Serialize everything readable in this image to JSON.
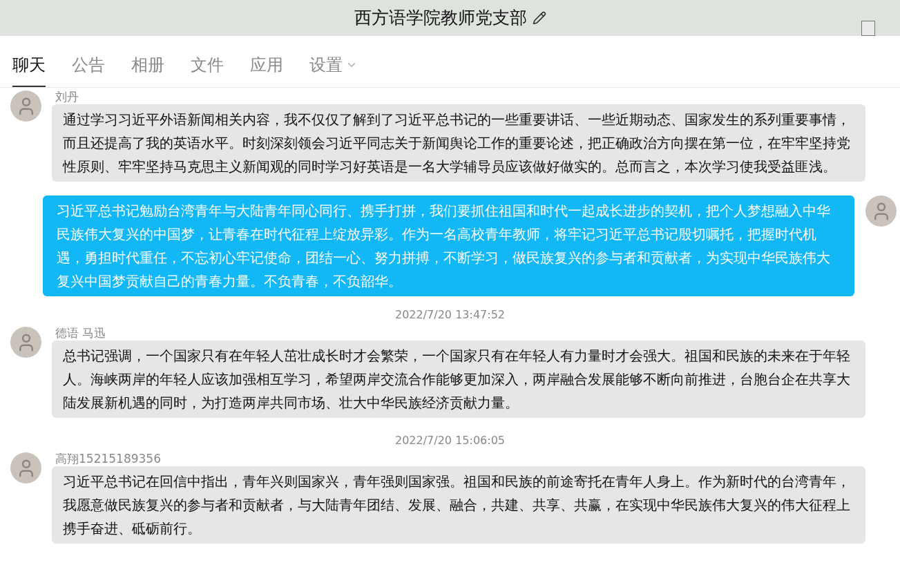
{
  "header": {
    "title": "西方语学院教师党支部"
  },
  "tabs": [
    {
      "label": "聊天",
      "selected": true,
      "dropdown": false
    },
    {
      "label": "公告",
      "selected": false,
      "dropdown": false
    },
    {
      "label": "相册",
      "selected": false,
      "dropdown": false
    },
    {
      "label": "文件",
      "selected": false,
      "dropdown": false
    },
    {
      "label": "应用",
      "selected": false,
      "dropdown": false
    },
    {
      "label": "设置",
      "selected": false,
      "dropdown": true
    }
  ],
  "messages": [
    {
      "kind": "received",
      "sender": "刘丹",
      "text": "通过学习习近平外语新闻相关内容，我不仅仅了解到了习近平总书记的一些重要讲话、一些近期动态、国家发生的系列重要事情，而且还提高了我的英语水平。时刻深刻领会习近平同志关于新闻舆论工作的重要论述，把正确政治方向摆在第一位，在牢牢坚持党性原则、牢牢坚持马克思主义新闻观的同时学习好英语是一名大学辅导员应该做好做实的。总而言之，本次学习使我受益匪浅。"
    },
    {
      "kind": "sent",
      "text": "习近平总书记勉励台湾青年与大陆青年同心同行、携手打拼，我们要抓住祖国和时代一起成长进步的契机，把个人梦想融入中华民族伟大复兴的中国梦，让青春在时代征程上绽放异彩。作为一名高校青年教师，将牢记习近平总书记殷切嘱托，把握时代机遇，勇担时代重任，不忘初心牢记使命，团结一心、努力拼搏，不断学习，做民族复兴的参与者和贡献者，为实现中华民族伟大复兴中国梦贡献自己的青春力量。不负青春，不负韶华。"
    },
    {
      "kind": "time",
      "text": "2022/7/20 13:47:52"
    },
    {
      "kind": "received",
      "sender": "德语 马迅",
      "text": "总书记强调，一个国家只有在年轻人茁壮成长时才会繁荣，一个国家只有在年轻人有力量时才会强大。祖国和民族的未来在于年轻人。海峡两岸的年轻人应该加强相互学习，希望两岸交流合作能够更加深入，两岸融合发展能够不断向前推进，台胞台企在共享大陆发展新机遇的同时，为打造两岸共同市场、壮大中华民族经济贡献力量。"
    },
    {
      "kind": "time",
      "text": "2022/7/20 15:06:05"
    },
    {
      "kind": "received",
      "sender": "高翔15215189356",
      "text": "习近平总书记在回信中指出，青年兴则国家兴，青年强则国家强。祖国和民族的前途寄托在青年人身上。作为新时代的台湾青年，我愿意做民族复兴的参与者和贡献者，与大陆青年团结、发展、融合，共建、共享、共赢，在实现中华民族伟大复兴的伟大征程上携手奋进、砥砺前行。"
    }
  ]
}
